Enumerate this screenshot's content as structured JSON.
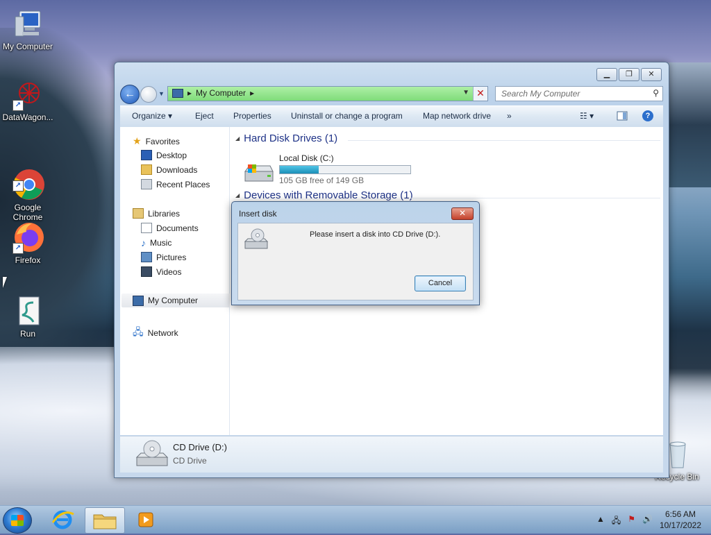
{
  "desktop": {
    "icons": [
      {
        "label": "My Computer"
      },
      {
        "label": "DataWagon..."
      },
      {
        "label": "Google\nChrome"
      },
      {
        "label": "Firefox"
      },
      {
        "label": "Run"
      },
      {
        "label": "Recycle Bin"
      }
    ]
  },
  "explorer": {
    "address_path": "My Computer",
    "search_placeholder": "Search My Computer",
    "toolbar": {
      "organize": "Organize",
      "eject": "Eject",
      "properties": "Properties",
      "uninstall": "Uninstall or change a program",
      "map_drive": "Map network drive",
      "more": "»"
    },
    "nav": {
      "favorites": "Favorites",
      "desktop": "Desktop",
      "downloads": "Downloads",
      "recent": "Recent Places",
      "libraries": "Libraries",
      "documents": "Documents",
      "music": "Music",
      "pictures": "Pictures",
      "videos": "Videos",
      "my_computer": "My Computer",
      "network": "Network"
    },
    "groups": {
      "hdd": "Hard Disk Drives (1)",
      "removable": "Devices with Removable Storage (1)"
    },
    "local_disk": {
      "name": "Local Disk (C:)",
      "free_text": "105 GB free of 149 GB",
      "used_fraction": 0.3
    },
    "details": {
      "name": "CD Drive (D:)",
      "type": "CD Drive"
    }
  },
  "dialog": {
    "title": "Insert disk",
    "message": "Please insert a disk into CD Drive (D:).",
    "cancel": "Cancel"
  },
  "taskbar": {
    "time": "6:56 AM",
    "date": "10/17/2022"
  },
  "colors": {
    "accent": "#1e3287",
    "address_bar": "#7fdc7a",
    "disk_fill": "#1b8fb8"
  }
}
